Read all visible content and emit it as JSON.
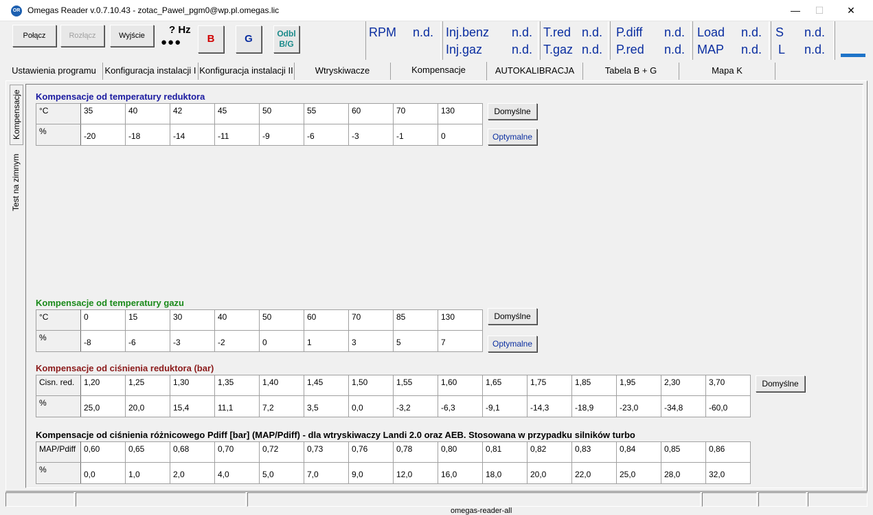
{
  "window": {
    "title": "Omegas Reader v.0.7.10.43  -  zotac_Pawel_pgm0@wp.pl.omegas.lic",
    "icon_text": "OR",
    "minimize": "—",
    "maximize": "☐",
    "close": "✕"
  },
  "toolbar": {
    "connect": "Połącz",
    "disconnect": "Rozłącz",
    "exit": "Wyjście",
    "hz": "? Hz",
    "dots": "●●●",
    "b": "B",
    "g": "G",
    "odbl_line1": "Odbl",
    "odbl_line2": "B/G"
  },
  "status": {
    "rpm_label": "RPM",
    "rpm_value": "n.d.",
    "injbenz_label": "Inj.benz",
    "injbenz_value": "n.d.",
    "injgaz_label": "Inj.gaz",
    "injgaz_value": "n.d.",
    "tred_label": "T.red",
    "tred_value": "n.d.",
    "tgaz_label": "T.gaz",
    "tgaz_value": "n.d.",
    "pdiff_label": "P.diff",
    "pdiff_value": "n.d.",
    "pred_label": "P.red",
    "pred_value": "n.d.",
    "load_label": "Load",
    "load_value": "n.d.",
    "map_label": "MAP",
    "map_value": "n.d.",
    "s_label": "S",
    "s_value": "n.d.",
    "l_label": "L",
    "l_value": "n.d."
  },
  "colors": {
    "status_text": "#0a2ea0",
    "reductor_title": "#1a1aa0",
    "gas_title": "#1a8a1a",
    "pressure_title": "#8b1a1a",
    "pdiff_title": "#000000",
    "progress": "#1e74c8"
  },
  "tabs": [
    "Ustawienia programu",
    "Konfiguracja instalacji I",
    "Konfiguracja instalacji II",
    "Wtryskiwacze",
    "Kompensacje",
    "AUTOKALIBRACJA",
    "Tabela B + G",
    "Mapa K"
  ],
  "active_tab": "Kompensacje",
  "side_tabs": [
    "Kompensacje",
    "Test na zimnym"
  ],
  "sections": {
    "reductor": {
      "title": "Kompensacje od temperatury reduktora",
      "row1_label": "°C",
      "row2_label": "%",
      "row1": [
        "35",
        "40",
        "42",
        "45",
        "50",
        "55",
        "60",
        "70",
        "130"
      ],
      "row2": [
        "-20",
        "-18",
        "-14",
        "-11",
        "-9",
        "-6",
        "-3",
        "-1",
        "0"
      ],
      "btn_default": "Domyślne",
      "btn_optimal": "Optymalne"
    },
    "gas": {
      "title": "Kompensacje od temperatury gazu",
      "row1_label": "°C",
      "row2_label": "%",
      "row1": [
        "0",
        "15",
        "30",
        "40",
        "50",
        "60",
        "70",
        "85",
        "130"
      ],
      "row2": [
        "-8",
        "-6",
        "-3",
        "-2",
        "0",
        "1",
        "3",
        "5",
        "7"
      ],
      "btn_default": "Domyślne",
      "btn_optimal": "Optymalne"
    },
    "pressure": {
      "title": "Kompensacje od ciśnienia reduktora (bar)",
      "row1_label": "Cisn. red.",
      "row2_label": "%",
      "row1": [
        "1,20",
        "1,25",
        "1,30",
        "1,35",
        "1,40",
        "1,45",
        "1,50",
        "1,55",
        "1,60",
        "1,65",
        "1,75",
        "1,85",
        "1,95",
        "2,30",
        "3,70"
      ],
      "row2": [
        "25,0",
        "20,0",
        "15,4",
        "11,1",
        "7,2",
        "3,5",
        "0,0",
        "-3,2",
        "-6,3",
        "-9,1",
        "-14,3",
        "-18,9",
        "-23,0",
        "-34,8",
        "-60,0"
      ],
      "btn_default": "Domyślne"
    },
    "pdiff": {
      "title": "Kompensacje od ciśnienia różnicowego Pdiff [bar] (MAP/Pdiff) - dla wtryskiwaczy Landi 2.0 oraz AEB. Stosowana w przypadku silników turbo",
      "row1_label": "MAP/Pdiff",
      "row2_label": "%",
      "row1": [
        "0,60",
        "0,65",
        "0,68",
        "0,70",
        "0,72",
        "0,73",
        "0,76",
        "0,78",
        "0,80",
        "0,81",
        "0,82",
        "0,83",
        "0,84",
        "0,85",
        "0,86"
      ],
      "row2": [
        "0,0",
        "1,0",
        "2,0",
        "4,0",
        "5,0",
        "7,0",
        "9,0",
        "12,0",
        "16,0",
        "18,0",
        "20,0",
        "22,0",
        "25,0",
        "28,0",
        "32,0"
      ]
    }
  },
  "taskbar_fragment": "omegas-reader-all"
}
